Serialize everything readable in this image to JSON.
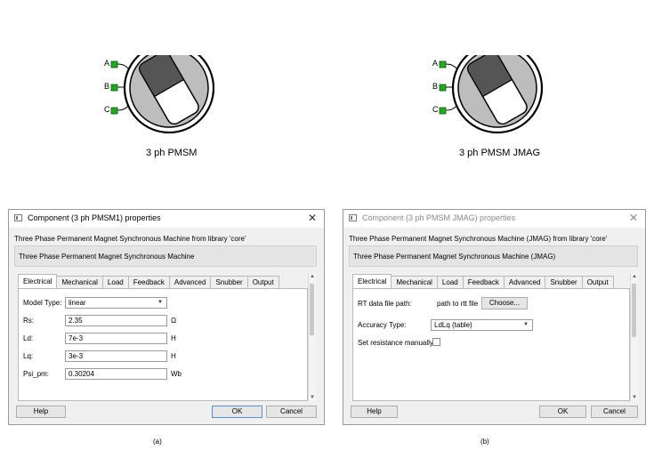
{
  "symbols": [
    {
      "label": "3 ph PMSM",
      "ports": [
        "A",
        "B",
        "C"
      ]
    },
    {
      "label": "3 ph PMSM JMAG",
      "ports": [
        "A",
        "B",
        "C"
      ]
    }
  ],
  "dialog_a": {
    "title": "Component (3 ph PMSM1) properties",
    "description": "Three Phase Permanent Magnet Synchronous Machine from library 'core'",
    "name_box": "Three Phase Permanent Magnet Synchronous Machine",
    "tabs": [
      "Electrical",
      "Mechanical",
      "Load",
      "Feedback",
      "Advanced",
      "Snubber",
      "Output"
    ],
    "active_tab": "Electrical",
    "model_type": {
      "label": "Model Type:",
      "value": "linear"
    },
    "params": [
      {
        "label": "Rs:",
        "value": "2.35",
        "unit": "Ω"
      },
      {
        "label": "Ld:",
        "value": "7e-3",
        "unit": "H"
      },
      {
        "label": "Lq:",
        "value": "3e-3",
        "unit": "H"
      },
      {
        "label": "Psi_pm:",
        "value": "0.30204",
        "unit": "Wb"
      }
    ],
    "buttons": {
      "help": "Help",
      "ok": "OK",
      "cancel": "Cancel"
    },
    "caption": "(a)"
  },
  "dialog_b": {
    "title": "Component (3 ph PMSM JMAG) properties",
    "description": "Three Phase Permanent Magnet Synchronous Machine (JMAG) from library 'core'",
    "name_box": "Three Phase Permanent Magnet Synchronous Machine (JMAG)",
    "tabs": [
      "Electrical",
      "Mechanical",
      "Load",
      "Feedback",
      "Advanced",
      "Snubber",
      "Output"
    ],
    "active_tab": "Electrical",
    "rt_file": {
      "label": "RT data file path:",
      "value": "path to rtt file",
      "button": "Choose..."
    },
    "accuracy": {
      "label": "Accuracy Type:",
      "value": "LdLq (table)"
    },
    "resistance": {
      "label": "Set resistance manually:",
      "checked": false
    },
    "buttons": {
      "help": "Help",
      "ok": "OK",
      "cancel": "Cancel"
    },
    "caption": "(b)"
  },
  "colors": {
    "port": "#22aa22",
    "rotor_dark": "#555555",
    "stator": "#bdbdbd",
    "focus_border": "#5a8fd4"
  }
}
